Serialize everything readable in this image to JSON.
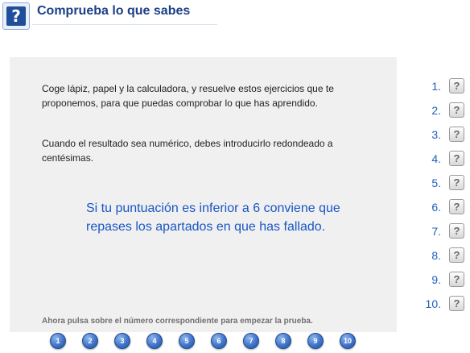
{
  "header": {
    "icon": "question-icon",
    "icon_glyph": "?",
    "title": "Comprueba lo que sabes"
  },
  "panel": {
    "paragraph1": "Coge lápiz, papel y la calculadora, y resuelve estos ejercicios que te proponemos,  para que puedas comprobar lo que has aprendido.",
    "paragraph2": "Cuando el resultado sea numérico, debes introducirlo redondeado a centésimas.",
    "note": "Si tu puntuación es inferior a 6 conviene que repases los apartados en que has fallado.",
    "instruction": "Ahora pulsa sobre el número correspondiente para empezar la prueba."
  },
  "circles": [
    "1",
    "2",
    "3",
    "4",
    "5",
    "6",
    "7",
    "8",
    "9",
    "10"
  ],
  "questions": [
    {
      "label": "1.",
      "glyph": "?"
    },
    {
      "label": "2.",
      "glyph": "?"
    },
    {
      "label": "3.",
      "glyph": "?"
    },
    {
      "label": "4.",
      "glyph": "?"
    },
    {
      "label": "5.",
      "glyph": "?"
    },
    {
      "label": "6.",
      "glyph": "?"
    },
    {
      "label": "7.",
      "glyph": "?"
    },
    {
      "label": "8.",
      "glyph": "?"
    },
    {
      "label": "9.",
      "glyph": "?"
    },
    {
      "label": "10.",
      "glyph": "?"
    }
  ]
}
